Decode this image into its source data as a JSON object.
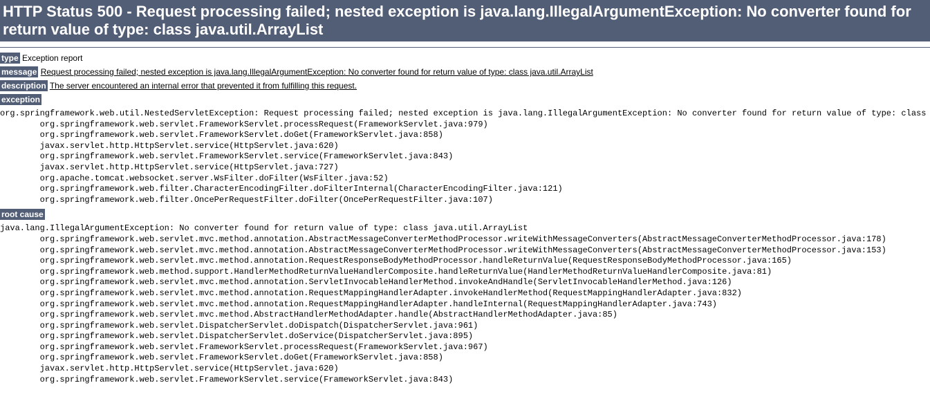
{
  "title": "HTTP Status 500 - Request processing failed; nested exception is java.lang.IllegalArgumentException: No converter found for return value of type: class java.util.ArrayList",
  "type": {
    "label": "type",
    "value": "Exception report"
  },
  "message": {
    "label": "message",
    "value": "Request processing failed; nested exception is java.lang.IllegalArgumentException: No converter found for return value of type: class java.util.ArrayList"
  },
  "description": {
    "label": "description",
    "value": "The server encountered an internal error that prevented it from fulfilling this request."
  },
  "exception": {
    "label": "exception",
    "trace": "org.springframework.web.util.NestedServletException: Request processing failed; nested exception is java.lang.IllegalArgumentException: No converter found for return value of type: class java.util.ArrayList\n\torg.springframework.web.servlet.FrameworkServlet.processRequest(FrameworkServlet.java:979)\n\torg.springframework.web.servlet.FrameworkServlet.doGet(FrameworkServlet.java:858)\n\tjavax.servlet.http.HttpServlet.service(HttpServlet.java:620)\n\torg.springframework.web.servlet.FrameworkServlet.service(FrameworkServlet.java:843)\n\tjavax.servlet.http.HttpServlet.service(HttpServlet.java:727)\n\torg.apache.tomcat.websocket.server.WsFilter.doFilter(WsFilter.java:52)\n\torg.springframework.web.filter.CharacterEncodingFilter.doFilterInternal(CharacterEncodingFilter.java:121)\n\torg.springframework.web.filter.OncePerRequestFilter.doFilter(OncePerRequestFilter.java:107)"
  },
  "rootcause": {
    "label": "root cause",
    "trace": "java.lang.IllegalArgumentException: No converter found for return value of type: class java.util.ArrayList\n\torg.springframework.web.servlet.mvc.method.annotation.AbstractMessageConverterMethodProcessor.writeWithMessageConverters(AbstractMessageConverterMethodProcessor.java:178)\n\torg.springframework.web.servlet.mvc.method.annotation.AbstractMessageConverterMethodProcessor.writeWithMessageConverters(AbstractMessageConverterMethodProcessor.java:153)\n\torg.springframework.web.servlet.mvc.method.annotation.RequestResponseBodyMethodProcessor.handleReturnValue(RequestResponseBodyMethodProcessor.java:165)\n\torg.springframework.web.method.support.HandlerMethodReturnValueHandlerComposite.handleReturnValue(HandlerMethodReturnValueHandlerComposite.java:81)\n\torg.springframework.web.servlet.mvc.method.annotation.ServletInvocableHandlerMethod.invokeAndHandle(ServletInvocableHandlerMethod.java:126)\n\torg.springframework.web.servlet.mvc.method.annotation.RequestMappingHandlerAdapter.invokeHandlerMethod(RequestMappingHandlerAdapter.java:832)\n\torg.springframework.web.servlet.mvc.method.annotation.RequestMappingHandlerAdapter.handleInternal(RequestMappingHandlerAdapter.java:743)\n\torg.springframework.web.servlet.mvc.method.AbstractHandlerMethodAdapter.handle(AbstractHandlerMethodAdapter.java:85)\n\torg.springframework.web.servlet.DispatcherServlet.doDispatch(DispatcherServlet.java:961)\n\torg.springframework.web.servlet.DispatcherServlet.doService(DispatcherServlet.java:895)\n\torg.springframework.web.servlet.FrameworkServlet.processRequest(FrameworkServlet.java:967)\n\torg.springframework.web.servlet.FrameworkServlet.doGet(FrameworkServlet.java:858)\n\tjavax.servlet.http.HttpServlet.service(HttpServlet.java:620)\n\torg.springframework.web.servlet.FrameworkServlet.service(FrameworkServlet.java:843)"
  }
}
